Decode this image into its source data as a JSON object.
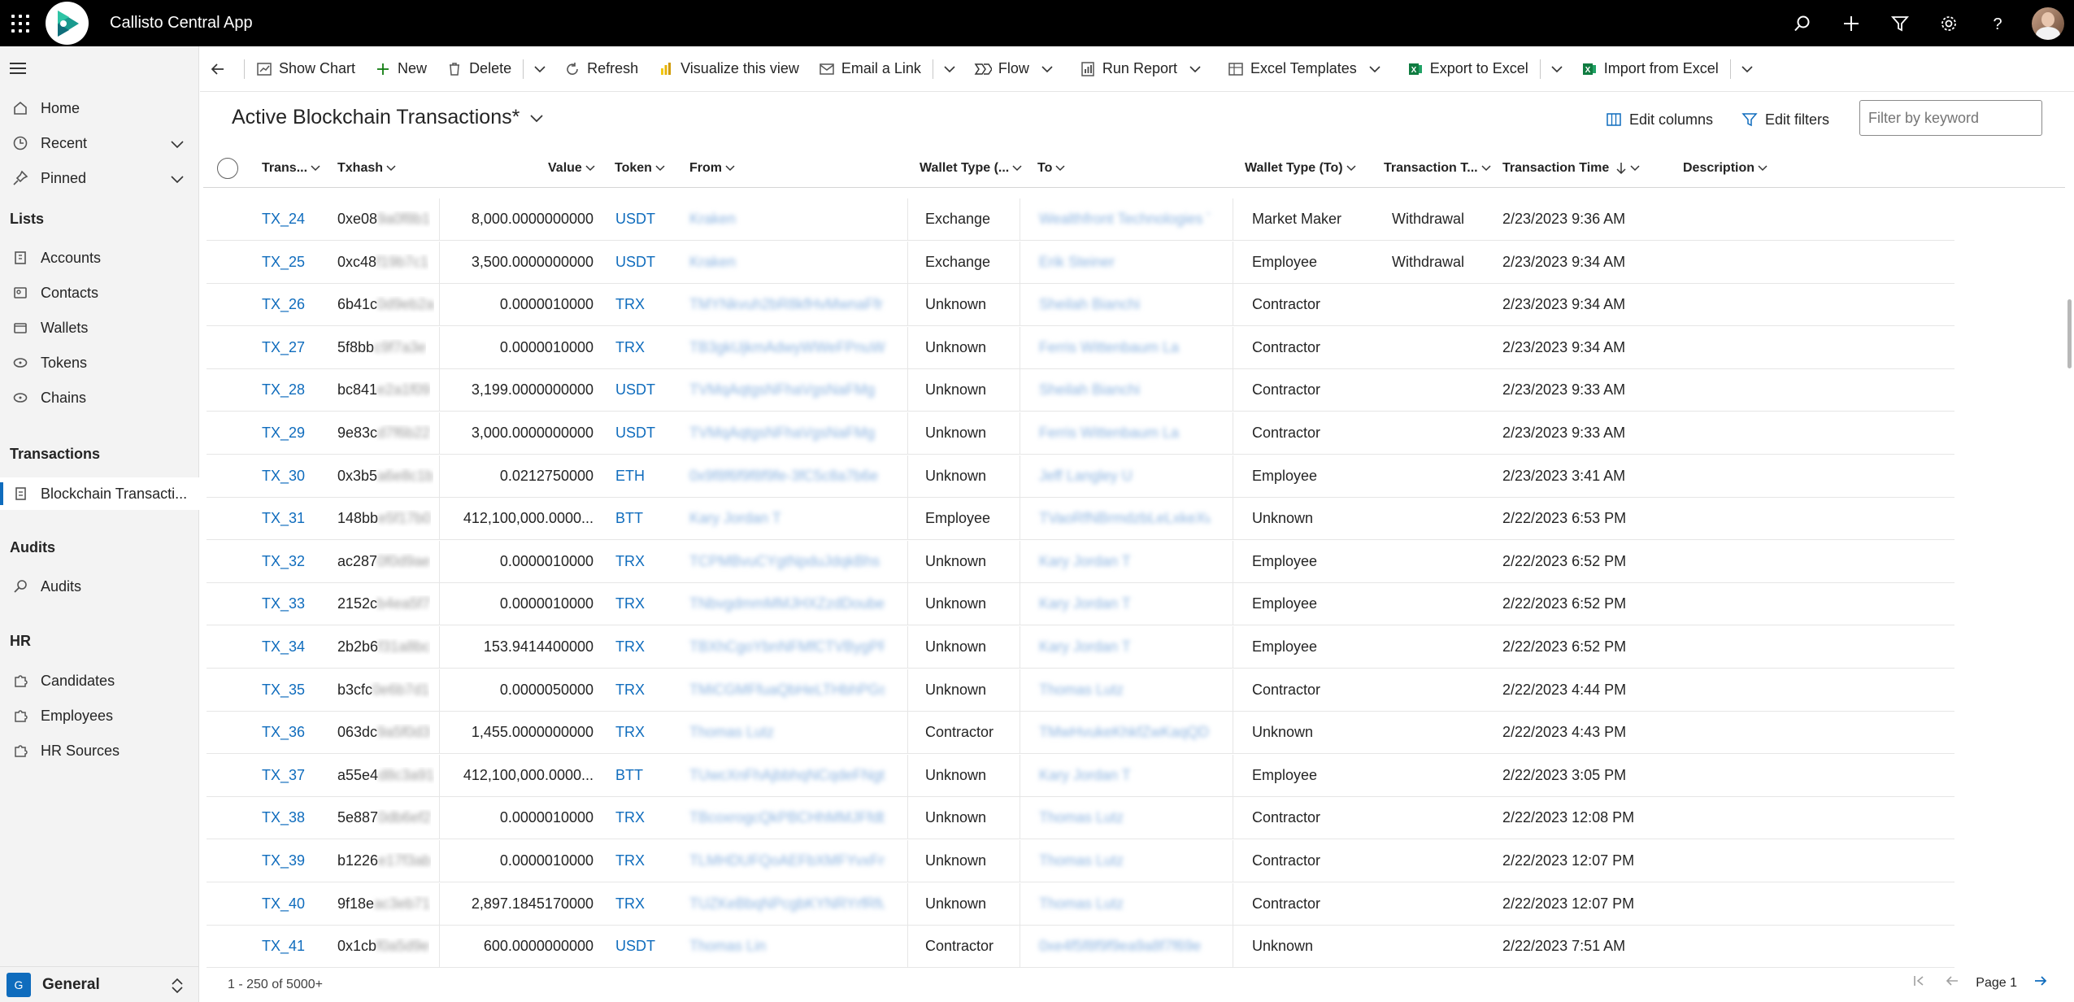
{
  "app": {
    "title": "Callisto Central App"
  },
  "top_icons": [
    "search-icon",
    "plus-icon",
    "filter-icon",
    "gear-icon",
    "help-icon"
  ],
  "sidebar": {
    "items_top": [
      {
        "label": "Home",
        "icon": "home-icon"
      },
      {
        "label": "Recent",
        "icon": "clock-icon"
      },
      {
        "label": "Pinned",
        "icon": "pin-icon"
      }
    ],
    "sections": [
      {
        "title": "Lists",
        "items": [
          "Accounts",
          "Contacts",
          "Wallets",
          "Tokens",
          "Chains"
        ]
      },
      {
        "title": "Transactions",
        "items": [
          "Blockchain Transacti..."
        ]
      },
      {
        "title": "Audits",
        "items": [
          "Audits"
        ]
      },
      {
        "title": "HR",
        "items": [
          "Candidates",
          "Employees",
          "HR Sources"
        ]
      }
    ],
    "area": {
      "badge": "G",
      "label": "General"
    }
  },
  "commands": {
    "show_chart": "Show Chart",
    "new": "New",
    "delete": "Delete",
    "refresh": "Refresh",
    "visualize": "Visualize this view",
    "email": "Email a Link",
    "flow": "Flow",
    "run_report": "Run Report",
    "excel_templates": "Excel Templates",
    "export_excel": "Export to Excel",
    "import_excel": "Import from Excel"
  },
  "view": {
    "title": "Active Blockchain Transactions*",
    "edit_columns": "Edit columns",
    "edit_filters": "Edit filters",
    "filter_placeholder": "Filter by keyword"
  },
  "columns": [
    "Trans...",
    "Txhash",
    "Value",
    "Token",
    "From",
    "Wallet Type (...",
    "To",
    "Wallet Type (To)",
    "Transaction T...",
    "Transaction Time",
    "Description"
  ],
  "rows": [
    {
      "id": "TX_24",
      "hash": "0xe08",
      "hash_blur": "9a0f8b1",
      "value": "8,000.0000000000",
      "token": "USDT",
      "from": "Kraken",
      "wtype_from": "Exchange",
      "to": "Wealthfront Technologies T",
      "wtype_to": "Market Maker",
      "ttype": "Withdrawal",
      "time": "2/23/2023 9:36 AM"
    },
    {
      "id": "TX_25",
      "hash": "0xc48",
      "hash_blur": "f19b7c1",
      "value": "3,500.0000000000",
      "token": "USDT",
      "from": "Kraken",
      "wtype_from": "Exchange",
      "to": "Erik Steiner",
      "wtype_to": "Employee",
      "ttype": "Withdrawal",
      "time": "2/23/2023 9:34 AM"
    },
    {
      "id": "TX_26",
      "hash": "6b41c",
      "hash_blur": "0d9eb2a",
      "value": "0.0000010000",
      "token": "TRX",
      "from": "TMYNkvuh2bR8kfHvMwnaFfr",
      "wtype_from": "Unknown",
      "to": "Sheilah Bianchi",
      "wtype_to": "Contractor",
      "ttype": "",
      "time": "2/23/2023 9:34 AM"
    },
    {
      "id": "TX_27",
      "hash": "5f8bb",
      "hash_blur": "c9f7a3e",
      "value": "0.0000010000",
      "token": "TRX",
      "from": "TB3gkUjkmAdwyWWeFPnuWr",
      "wtype_from": "Unknown",
      "to": "Ferris Wittenbaum La",
      "wtype_to": "Contractor",
      "ttype": "",
      "time": "2/23/2023 9:34 AM"
    },
    {
      "id": "TX_28",
      "hash": "bc841",
      "hash_blur": "e2a1f09",
      "value": "3,199.0000000000",
      "token": "USDT",
      "from": "TVMqAqtgsNFhaVgsNaFMg",
      "wtype_from": "Unknown",
      "to": "Sheilah Bianchi",
      "wtype_to": "Contractor",
      "ttype": "",
      "time": "2/23/2023 9:33 AM"
    },
    {
      "id": "TX_29",
      "hash": "9e83c",
      "hash_blur": "d7f6b22",
      "value": "3,000.0000000000",
      "token": "USDT",
      "from": "TVMqAqtgsNFhaVgsNaFMg",
      "wtype_from": "Unknown",
      "to": "Ferris Wittenbaum La",
      "wtype_to": "Contractor",
      "ttype": "",
      "time": "2/23/2023 9:33 AM"
    },
    {
      "id": "TX_30",
      "hash": "0x3b5",
      "hash_blur": "a6e8c1b",
      "value": "0.0212750000",
      "token": "ETH",
      "from": "0x9f8f6f9f8f9fe-3fC5c8a7b6e",
      "wtype_from": "Unknown",
      "to": "Jeff Langley U",
      "wtype_to": "Employee",
      "ttype": "",
      "time": "2/23/2023 3:41 AM"
    },
    {
      "id": "TX_31",
      "hash": "148bb",
      "hash_blur": "e5f17b0",
      "value": "412,100,000.0000...",
      "token": "BTT",
      "from": "Kary Jordan T",
      "wtype_from": "Employee",
      "to": "TVaoRfNBrmdzbLeLxkeXwGTs",
      "wtype_to": "Unknown",
      "ttype": "",
      "time": "2/22/2023 6:53 PM"
    },
    {
      "id": "TX_32",
      "hash": "ac287",
      "hash_blur": "0f0d9ae",
      "value": "0.0000010000",
      "token": "TRX",
      "from": "TCPMBvuCYgtNpduJdqkBhs",
      "wtype_from": "Unknown",
      "to": "Kary Jordan T",
      "wtype_to": "Employee",
      "ttype": "",
      "time": "2/22/2023 6:52 PM"
    },
    {
      "id": "TX_33",
      "hash": "2152c",
      "hash_blur": "b4ea5f7",
      "value": "0.0000010000",
      "token": "TRX",
      "from": "TNbvgdmmMMJHXZzdDoube",
      "wtype_from": "Unknown",
      "to": "Kary Jordan T",
      "wtype_to": "Employee",
      "ttype": "",
      "time": "2/22/2023 6:52 PM"
    },
    {
      "id": "TX_34",
      "hash": "2b2b6",
      "hash_blur": "f31a8bc",
      "value": "153.9414400000",
      "token": "TRX",
      "from": "TBXhCgoYbnNFMfCTVBygPF",
      "wtype_from": "Unknown",
      "to": "Kary Jordan T",
      "wtype_to": "Employee",
      "ttype": "",
      "time": "2/22/2023 6:52 PM"
    },
    {
      "id": "TX_35",
      "hash": "b3cfc",
      "hash_blur": "0e6b7d1",
      "value": "0.0000050000",
      "token": "TRX",
      "from": "TMiCGMFfuaQbHeLTHbhPGs",
      "wtype_from": "Unknown",
      "to": "Thomas Lutz",
      "wtype_to": "Contractor",
      "ttype": "",
      "time": "2/22/2023 4:44 PM"
    },
    {
      "id": "TX_36",
      "hash": "063dc",
      "hash_blur": "9a5f0d3",
      "value": "1,455.0000000000",
      "token": "TRX",
      "from": "Thomas Lutz",
      "wtype_from": "Contractor",
      "to": "TMwHvukeKhkfZwKaqQD",
      "wtype_to": "Unknown",
      "ttype": "",
      "time": "2/22/2023 4:43 PM"
    },
    {
      "id": "TX_37",
      "hash": "a55e4",
      "hash_blur": "d8c3a91",
      "value": "412,100,000.0000...",
      "token": "BTT",
      "from": "TUwcXnFhAjbbhqNCqdeFNgt",
      "wtype_from": "Unknown",
      "to": "Kary Jordan T",
      "wtype_to": "Employee",
      "ttype": "",
      "time": "2/22/2023 3:05 PM"
    },
    {
      "id": "TX_38",
      "hash": "5e887",
      "hash_blur": "0db6ef2",
      "value": "0.0000010000",
      "token": "TRX",
      "from": "TBcoxrogcQkPBCHhMMJFfdb",
      "wtype_from": "Unknown",
      "to": "Thomas Lutz",
      "wtype_to": "Contractor",
      "ttype": "",
      "time": "2/22/2023 12:08 PM"
    },
    {
      "id": "TX_39",
      "hash": "b1226",
      "hash_blur": "e17f3ab",
      "value": "0.0000010000",
      "token": "TRX",
      "from": "TLMHDUFQoAEFbXMFYvxFm",
      "wtype_from": "Unknown",
      "to": "Thomas Lutz",
      "wtype_to": "Contractor",
      "ttype": "",
      "time": "2/22/2023 12:07 PM"
    },
    {
      "id": "TX_40",
      "hash": "9f18e",
      "hash_blur": "ac3eb71",
      "value": "2,897.1845170000",
      "token": "TRX",
      "from": "TUZKeBbqNPcgbKYNRYrfRfu",
      "wtype_from": "Unknown",
      "to": "Thomas Lutz",
      "wtype_to": "Contractor",
      "ttype": "",
      "time": "2/22/2023 12:07 PM"
    },
    {
      "id": "TX_41",
      "hash": "0x1cb",
      "hash_blur": "f0a5d9e",
      "value": "600.0000000000",
      "token": "USDT",
      "from": "Thomas Lin",
      "wtype_from": "Contractor",
      "to": "0xe4f5f8f9f9ea9a8f7f69e",
      "wtype_to": "Unknown",
      "ttype": "",
      "time": "2/22/2023 7:51 AM"
    }
  ],
  "footer": {
    "record_count": "1 - 250 of 5000+",
    "page_label": "Page 1"
  }
}
